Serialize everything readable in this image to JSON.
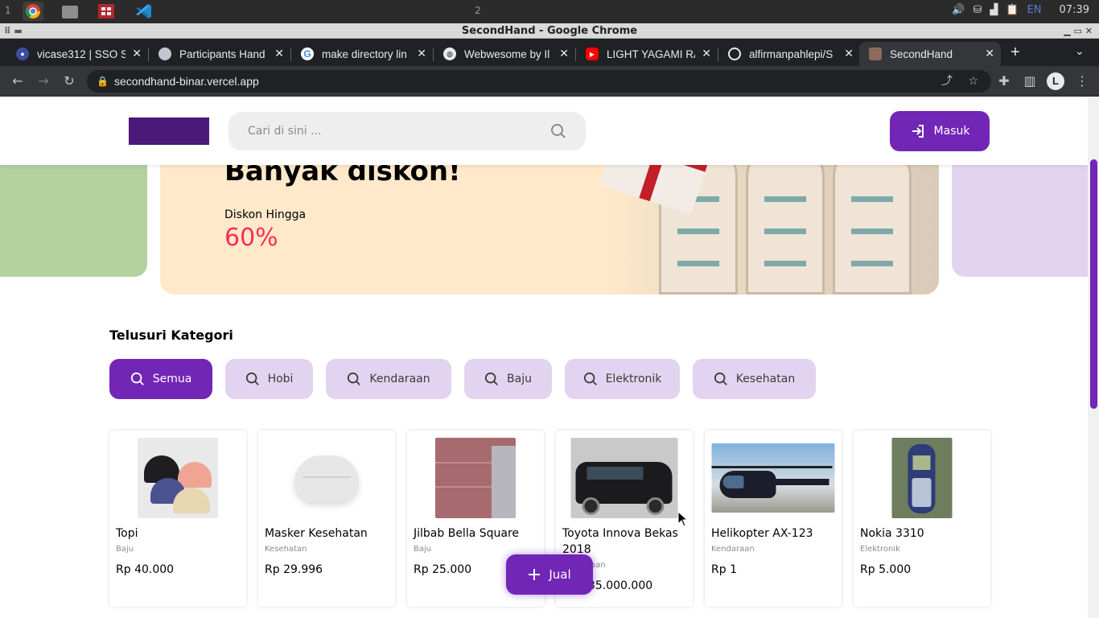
{
  "os": {
    "workspace_left": "1",
    "workspace_center": "2",
    "language": "EN",
    "clock": "07:39"
  },
  "window": {
    "title": "SecondHand - Google Chrome"
  },
  "tabs": [
    {
      "label": "vicase312 | SSO St",
      "favicon": "sso-icon"
    },
    {
      "label": "Participants Hand",
      "favicon": "profile-icon"
    },
    {
      "label": "make directory lin",
      "favicon": "google-icon"
    },
    {
      "label": "Webwesome by Il",
      "favicon": "globe-icon"
    },
    {
      "label": "LIGHT YAGAMI RA",
      "favicon": "youtube-icon"
    },
    {
      "label": "alfirmanpahlepi/S",
      "favicon": "github-icon"
    },
    {
      "label": "SecondHand",
      "favicon": "site-icon",
      "active": true
    }
  ],
  "address": {
    "url": "secondhand-binar.vercel.app"
  },
  "header": {
    "search_placeholder": "Cari di sini ...",
    "login_label": "Masuk"
  },
  "banner": {
    "title": "Banyak diskon!",
    "subtitle": "Diskon Hingga",
    "percent": "60%"
  },
  "categories": {
    "title": "Telusuri Kategori",
    "items": [
      "Semua",
      "Hobi",
      "Kendaraan",
      "Baju",
      "Elektronik",
      "Kesehatan"
    ],
    "active": "Semua"
  },
  "products": [
    {
      "name": "Topi",
      "category": "Baju",
      "price": "Rp 40.000"
    },
    {
      "name": "Masker Kesehatan",
      "category": "Kesehatan",
      "price": "Rp 29.996"
    },
    {
      "name": "Jilbab Bella Square",
      "category": "Baju",
      "price": "Rp 25.000"
    },
    {
      "name": "Toyota Innova Bekas 2018",
      "category": "Kendaraan",
      "price": "Rp 235.000.000"
    },
    {
      "name": "Helikopter AX-123",
      "category": "Kendaraan",
      "price": "Rp 1"
    },
    {
      "name": "Nokia 3310",
      "category": "Elektronik",
      "price": "Rp 5.000"
    }
  ],
  "fab": {
    "label": "Jual"
  },
  "colors": {
    "primary": "#7126b5",
    "chip": "#e2d4f0",
    "accent_red": "#fa2c5a",
    "banner_bg": "#ffe9ca"
  }
}
